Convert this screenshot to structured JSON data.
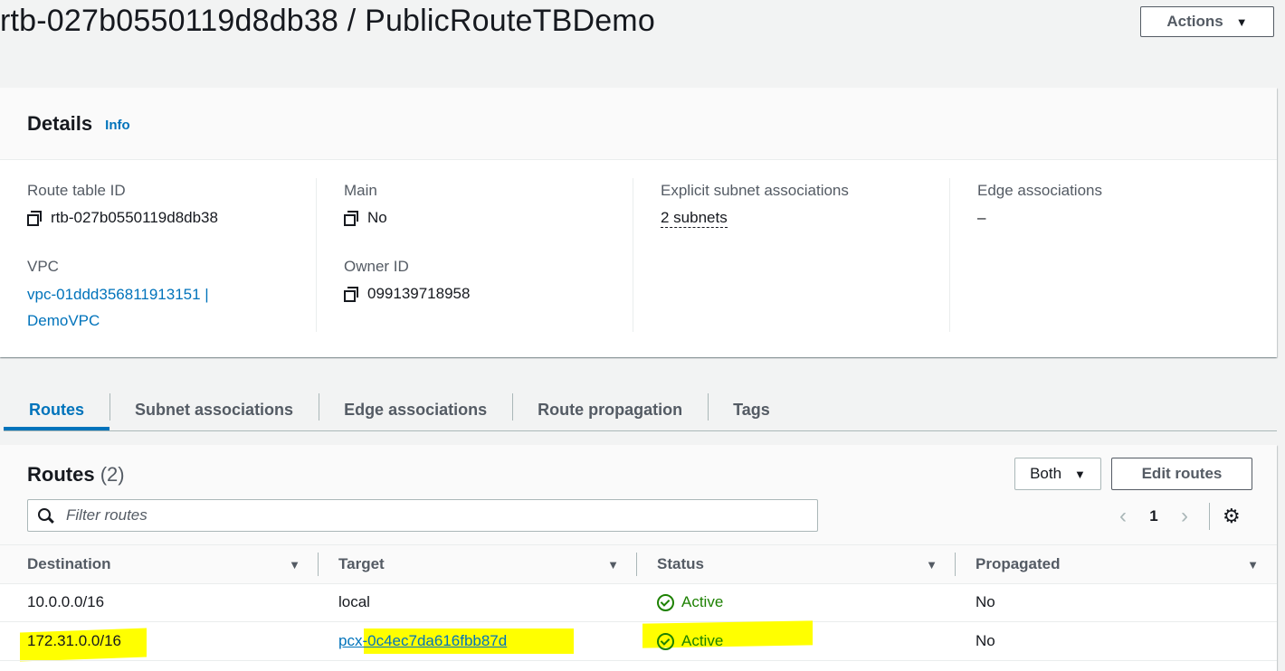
{
  "header": {
    "title": "rtb-027b0550119d8db38 / PublicRouteTBDemo",
    "actions_label": "Actions"
  },
  "details": {
    "title": "Details",
    "info_label": "Info",
    "route_table_id_label": "Route table ID",
    "route_table_id_value": "rtb-027b0550119d8db38",
    "vpc_label": "VPC",
    "vpc_value_line1": "vpc-01ddd356811913151 |",
    "vpc_value_line2": "DemoVPC",
    "main_label": "Main",
    "main_value": "No",
    "owner_id_label": "Owner ID",
    "owner_id_value": "099139718958",
    "explicit_subnet_label": "Explicit subnet associations",
    "explicit_subnet_value": "2 subnets",
    "edge_assoc_label": "Edge associations",
    "edge_assoc_value": "–"
  },
  "tabs": [
    {
      "label": "Routes",
      "active": true
    },
    {
      "label": "Subnet associations"
    },
    {
      "label": "Edge associations"
    },
    {
      "label": "Route propagation"
    },
    {
      "label": "Tags"
    }
  ],
  "routes": {
    "title": "Routes",
    "count": "(2)",
    "filter_select": "Both",
    "edit_label": "Edit routes",
    "filter_placeholder": "Filter routes",
    "page_number": "1",
    "columns": [
      "Destination",
      "Target",
      "Status",
      "Propagated"
    ],
    "rows": [
      {
        "destination": "10.0.0.0/16",
        "target": "local",
        "target_is_link": false,
        "status": "Active",
        "propagated": "No"
      },
      {
        "destination": "172.31.0.0/16",
        "target_prefix": "pcx",
        "target_suffix": "-0c4ec7da616fbb87d",
        "target_is_link": true,
        "status": "Active",
        "propagated": "No"
      }
    ]
  },
  "colors": {
    "link": "#0073bb",
    "success": "#1d8102",
    "highlight": "#ffff00"
  }
}
